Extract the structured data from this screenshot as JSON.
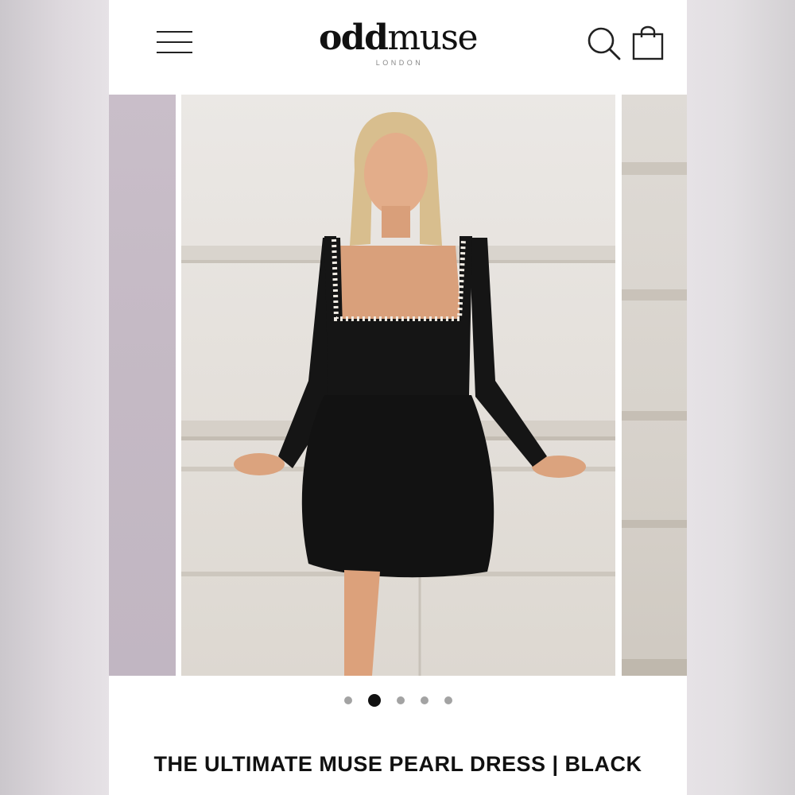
{
  "header": {
    "brand_bold": "odd",
    "brand_light": "muse",
    "brand_location": "LONDON",
    "icons": {
      "menu": "hamburger-menu-icon",
      "search": "search-icon",
      "bag": "shopping-bag-icon"
    }
  },
  "carousel": {
    "slide_count": 5,
    "active_index": 1,
    "zoom_icon": "zoom-magnifier-icon"
  },
  "product": {
    "title": "THE ULTIMATE MUSE PEARL DRESS | BLACK"
  },
  "colors": {
    "text": "#111111",
    "dot_inactive": "#a3a3a3",
    "dot_active": "#111111",
    "dress": "#151515"
  }
}
